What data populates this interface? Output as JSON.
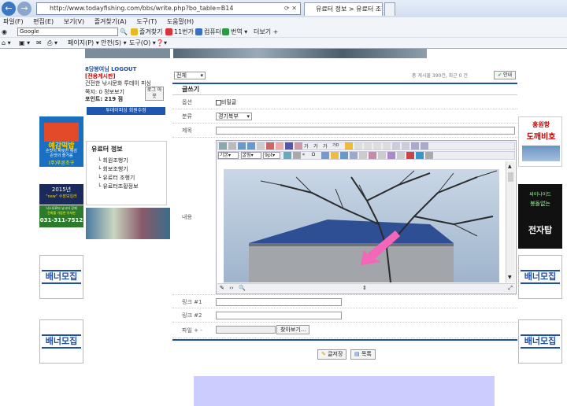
{
  "browser": {
    "url": "http://www.todayfishing.com/bbs/write.php?bo_table=B14",
    "tab_active": "유료터 정보 > 유료터 조행...",
    "menu": [
      "파일(F)",
      "편집(E)",
      "보기(V)",
      "즐겨찾기(A)",
      "도구(T)",
      "도움말(H)"
    ],
    "search_engine": "Google",
    "toolbar1": [
      "즐겨찾기",
      "11번가",
      "컴퓨터",
      "번역",
      "더보기"
    ],
    "toolbar2": [
      "페이지(P)",
      "안전(S)",
      "도구(O)"
    ]
  },
  "left_panel": {
    "user": "8당봉여님 LOGOUT",
    "board": "[전용게시판]",
    "desc": "건전한 낚시문화 투데이 피싱",
    "scrap": "쪽지: 0",
    "info": "정보보기",
    "logout_btn": "로그 아웃",
    "points": "포인트: 219 점",
    "edit_btn": "투데이피싱 회원수정",
    "menu_title": "유료터 정보",
    "menu_items": [
      "회원조행기",
      "회보조행기",
      "유료터 조행기",
      "유료터조황정보"
    ]
  },
  "banners": {
    "left_top_a": "예감떡밥",
    "left_top_b": "손맛이 짜릿한 예감",
    "left_top_c": "손맛의 즐거움",
    "left_top_d": "(주)푸른조구",
    "left_2015": "2015년",
    "left_2015b": "\"new\" 수장보일러",
    "left_phone_a": "낙소유료터 낚시터 강제",
    "left_phone_b": "진화를 거듭한 유지판",
    "left_phone": "031-311-7512",
    "recruit": "배너모집",
    "right_top_a": "홍원항",
    "right_top_b": "도깨비호",
    "right_mid_a": "싸이나이드",
    "right_mid_b": "봉돌없는",
    "right_mid_c": "전자탑"
  },
  "form": {
    "category_select": "전체",
    "stats": "총 게시물 390건, 최근 0 건",
    "info_btn": "안내",
    "title": "글쓰기",
    "option_label": "옵션",
    "option_secret": "비밀글",
    "category_label": "분류",
    "category_value": "경기북부",
    "subject_label": "제목",
    "content_label": "내용",
    "font_select": "기본",
    "font_face": "굴림",
    "font_size": "9pt",
    "link1_label": "링크 #1",
    "link2_label": "링크 #2",
    "file_label": "파일",
    "file_btn": "찾아보기...",
    "submit_btn": "글저장",
    "list_btn": "목록"
  }
}
